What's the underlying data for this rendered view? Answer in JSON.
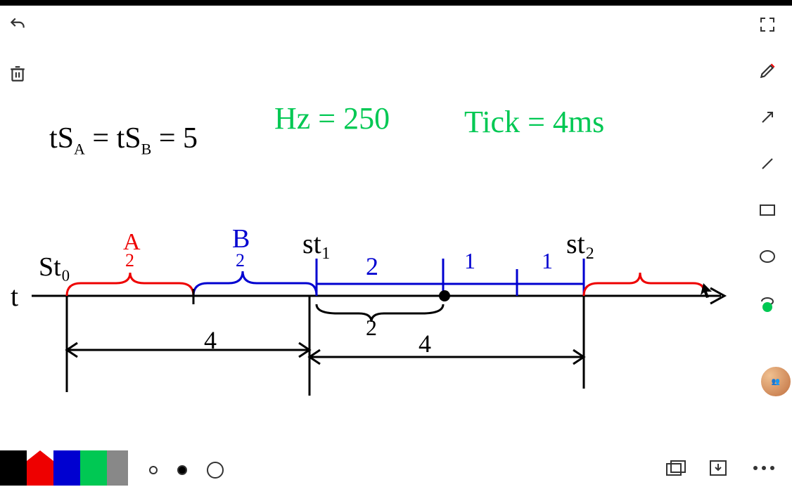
{
  "equations": {
    "ts_eq": "tS",
    "ts_a": "A",
    "eq1": " = tS",
    "ts_b": "B",
    "eq_val": " = 5",
    "hz": "Hz = 250",
    "tick": "Tick = 4ms"
  },
  "labels": {
    "st0": "St₀",
    "A": "A",
    "A_sub": "2",
    "B": "B",
    "B_sub": "2",
    "st1": "st₁",
    "mid2": "2",
    "one_a": "1",
    "one_b": "1",
    "st2": "st₂",
    "t": "t",
    "four_a": "4",
    "brace2": "2",
    "four_b": "4"
  },
  "palette": {
    "black": "#000000",
    "red": "#ee0000",
    "blue": "#0000d0",
    "green": "#00c853",
    "gray": "#888888"
  },
  "icons": {
    "undo": "undo",
    "trash": "trash",
    "expand": "expand",
    "pen": "pen",
    "arrow": "arrow",
    "line": "line",
    "rect": "rect",
    "ellipse": "ellipse",
    "lasso": "lasso",
    "windows": "windows",
    "download": "download",
    "more": "more"
  }
}
